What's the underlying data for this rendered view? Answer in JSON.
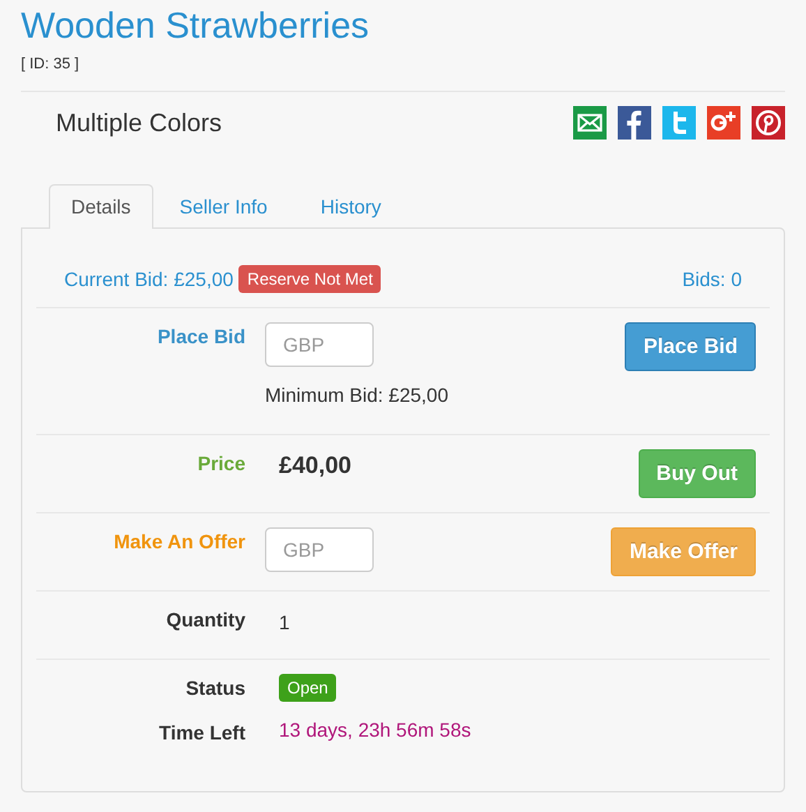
{
  "title": "Wooden Strawberries",
  "id_label": "[ ID: 35 ]",
  "subtitle": "Multiple Colors",
  "tabs": [
    {
      "label": "Details",
      "selected": true
    },
    {
      "label": "Seller Info",
      "selected": false
    },
    {
      "label": "History",
      "selected": false
    }
  ],
  "current_bid": {
    "text": "Current Bid: £25,00",
    "badge": "Reserve Not Met",
    "bids": "Bids: 0"
  },
  "rows": [
    {
      "kind": "bid",
      "label": "Place Bid",
      "placeholder": "GBP",
      "note": "Minimum Bid: £25,00",
      "button": "Place Bid"
    },
    {
      "kind": "price",
      "label": "Price",
      "value": "£40,00",
      "button": "Buy Out"
    },
    {
      "kind": "offer",
      "label": "Make An Offer",
      "placeholder": "GBP",
      "button": "Make Offer"
    },
    {
      "kind": "quantity",
      "label": "Quantity",
      "value": "1"
    },
    {
      "kind": "status",
      "label": "Status",
      "badge": "Open",
      "label2": "Time Left",
      "value": "13 days, 23h 56m 58s"
    }
  ]
}
